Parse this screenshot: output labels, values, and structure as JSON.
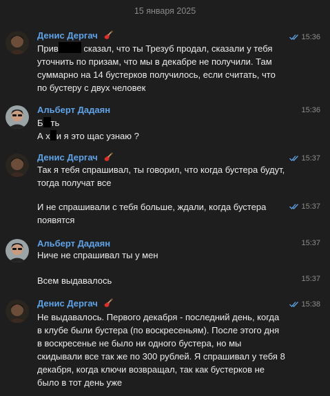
{
  "date_separator": "15 января 2025",
  "messages": [
    {
      "sender": "Денис Дергач",
      "time": "15:36",
      "text_a": "Прив",
      "text_b": " сказал, что ты Трезуб продал, сказали у тебя уточнить по призам, что мы в декабре не получили. Там суммарно на 14 бустерков получилось, если считать, что по бустеру с двух человек"
    },
    {
      "sender": "Альберт Дадаян",
      "time": "15:36",
      "line1_a": "Б",
      "line1_b": "ть",
      "line2_a": "А х",
      "line2_b": "и я это щас узнаю ?"
    },
    {
      "sender": "Денис Дергач",
      "time": "15:37",
      "text": "Так я тебя спрашивал, ты говорил, что когда бустера будут, тогда получат все"
    },
    {
      "time": "15:37",
      "text": "И не спрашивали с тебя больше, ждали, когда бустера появятся"
    },
    {
      "sender": "Альберт Дадаян",
      "time": "15:37",
      "text": "Ниче не спрашивал ты у мен"
    },
    {
      "time": "15:37",
      "text": "Всем выдавалось"
    },
    {
      "sender": "Денис Дергач",
      "time": "15:38",
      "text": "Не выдавалось. Первого декабря - последний день, когда в клубе были бустера (по воскресеньям). После этого дня в воскресенье не было ни одного бустера, но мы скидывали все так же по 300 рублей. Я спрашивал у тебя 8 декабря, когда ключи возвращал, так как бустерков не было в тот день уже"
    }
  ],
  "colors": {
    "background": "#1e1e1e",
    "sender_name": "#5fa3e8",
    "read_check": "#5fa3e8",
    "time": "#8d8d8d"
  },
  "icons": [
    "guitar-emoji-icon",
    "double-check-icon"
  ]
}
